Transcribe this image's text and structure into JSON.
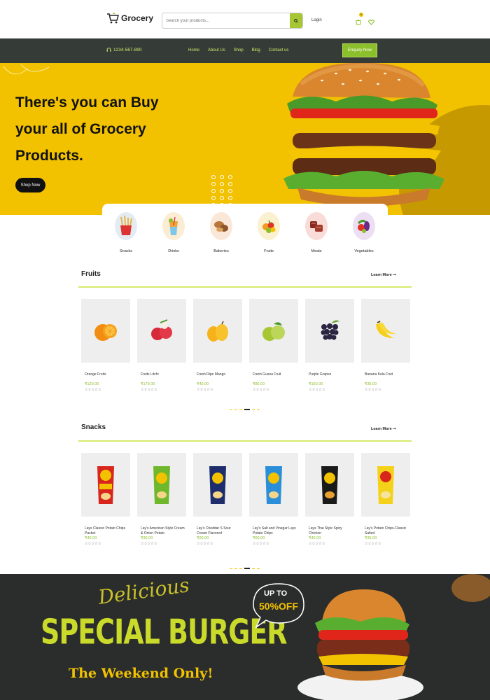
{
  "header": {
    "logo": "Grocery",
    "search_placeholder": "Search your products...",
    "login": "Login",
    "cart_count": "0"
  },
  "nav": {
    "phone": "1234-567-890",
    "links": [
      "Home",
      "About Us",
      "Shop",
      "Blog",
      "Contact us"
    ],
    "enquiry": "Enquiry Now"
  },
  "hero": {
    "title": "There's you can Buy your all of Grocery Products.",
    "button": "Shop Now"
  },
  "categories": [
    "Snacks",
    "Drinks",
    "Bakeries",
    "Fruits",
    "Meats",
    "Vegetables"
  ],
  "fruits": {
    "title": "Fruits",
    "learn_more": "Learn More ➞",
    "products": [
      {
        "name": "Orange Fruits",
        "price": "₹120.00",
        "stars": "☆☆☆☆☆"
      },
      {
        "name": "Fruits Litchi",
        "price": "₹170.00",
        "stars": "☆☆☆☆☆"
      },
      {
        "name": "Fresh Ripe Mango",
        "price": "₹40.00",
        "stars": "☆☆☆☆☆"
      },
      {
        "name": "Fresh Guava Fruit",
        "price": "₹80.00",
        "stars": "☆☆☆☆☆"
      },
      {
        "name": "Purple Grapes",
        "price": "₹150.00",
        "stars": "☆☆☆☆☆"
      },
      {
        "name": "Banana Kela Fruit",
        "price": "₹35.00",
        "stars": "☆☆☆☆☆"
      }
    ]
  },
  "snacks": {
    "title": "Snacks",
    "learn_more": "Learn More ➞",
    "products": [
      {
        "name": "Lays Classic Potato Chips Packet",
        "price": "₹40.00",
        "stars": "☆☆☆☆☆"
      },
      {
        "name": "Lay's American Style Cream & Onion Potato",
        "price": "₹30.00",
        "stars": "☆☆☆☆☆"
      },
      {
        "name": "Lay's Cheddar S Sour Cream Flavored",
        "price": "₹20.00",
        "stars": "☆☆☆☆☆"
      },
      {
        "name": "Lay's Salt and Vinegar Lays Potato Chips",
        "price": "₹60.00",
        "stars": "☆☆☆☆☆"
      },
      {
        "name": "Lays Thai Style Spicy Chicken",
        "price": "₹40.00",
        "stars": "☆☆☆☆☆"
      },
      {
        "name": "Lay's Potato Chips-Classic Salted",
        "price": "₹35.00",
        "stars": "☆☆☆☆☆"
      }
    ]
  },
  "promo": {
    "script": "Delicious",
    "title": "SPECIAL BURGER",
    "subtitle": "The Weekend Only!",
    "badge_line1": "UP TO",
    "badge_line2": "50%OFF"
  },
  "colors": {
    "accent_yellow": "#f2c200",
    "accent_green": "#8cbf2c",
    "dark_nav": "#353c38"
  }
}
